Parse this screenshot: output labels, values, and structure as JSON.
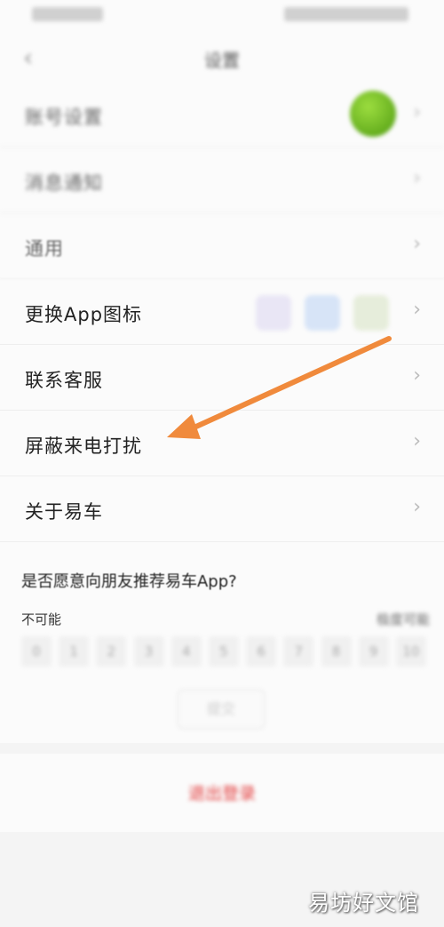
{
  "nav": {
    "title": "设置",
    "back": "‹"
  },
  "settings": [
    {
      "label": "账号设置"
    },
    {
      "label": "消息通知"
    },
    {
      "label": "通用"
    },
    {
      "label": "更换App图标"
    },
    {
      "label": "联系客服"
    },
    {
      "label": "屏蔽来电打扰"
    },
    {
      "label": "关于易车"
    }
  ],
  "chevron": "›",
  "survey": {
    "question": "是否愿意向朋友推荐易车App?",
    "low_label": "不可能",
    "high_label": "极度可能",
    "scale": [
      "0",
      "1",
      "2",
      "3",
      "4",
      "5",
      "6",
      "7",
      "8",
      "9",
      "10"
    ],
    "submit": "提交"
  },
  "logout": "退出登录",
  "watermark": "易坊好文馆",
  "colors": {
    "arrow": "#f08a3c",
    "logout": "#e23b3b",
    "avatar": "#6cb82a"
  }
}
